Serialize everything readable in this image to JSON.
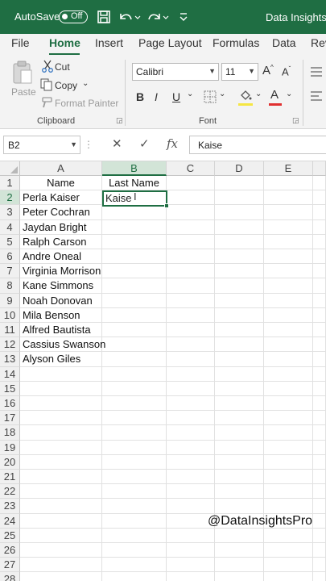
{
  "titlebar": {
    "autosave_label": "AutoSave",
    "autosave_state": "Off",
    "file_title": "Data Insights P",
    "bg_color": "#1f6e43"
  },
  "tabs": [
    "File",
    "Home",
    "Insert",
    "Page Layout",
    "Formulas",
    "Data",
    "Rev"
  ],
  "active_tab": "Home",
  "ribbon": {
    "clipboard": {
      "paste": "Paste",
      "cut": "Cut",
      "copy": "Copy",
      "format_painter": "Format Painter",
      "group_label": "Clipboard"
    },
    "font": {
      "font_name": "Calibri",
      "font_size": "11",
      "group_label": "Font",
      "bold": "B",
      "italic": "I",
      "underline": "U",
      "font_color": "#e03030",
      "fill_color": "#f5e642"
    }
  },
  "formula_bar": {
    "name_box": "B2",
    "value": "Kaise",
    "fx": "fx"
  },
  "grid": {
    "columns": [
      "A",
      "B",
      "C",
      "D",
      "E"
    ],
    "selected_column": "B",
    "rows": [
      "1",
      "2",
      "3",
      "4",
      "5",
      "6",
      "7",
      "8",
      "9",
      "10",
      "11",
      "12",
      "13",
      "14",
      "15",
      "16",
      "17",
      "18",
      "19",
      "20",
      "21",
      "22",
      "23",
      "24",
      "25",
      "26",
      "27",
      "28"
    ],
    "selected_row": "2",
    "col_a": [
      "Name",
      "Perla Kaiser",
      "Peter Cochran",
      "Jaydan Bright",
      "Ralph Carson",
      "Andre Oneal",
      "Virginia Morrison",
      "Kane Simmons",
      "Noah Donovan",
      "Mila Benson",
      "Alfred Bautista",
      "Cassius Swanson",
      "Alyson Giles"
    ],
    "col_b_header": "Last Name",
    "active_cell_value": "Kaise"
  },
  "watermark": "@DataInsightsPro"
}
